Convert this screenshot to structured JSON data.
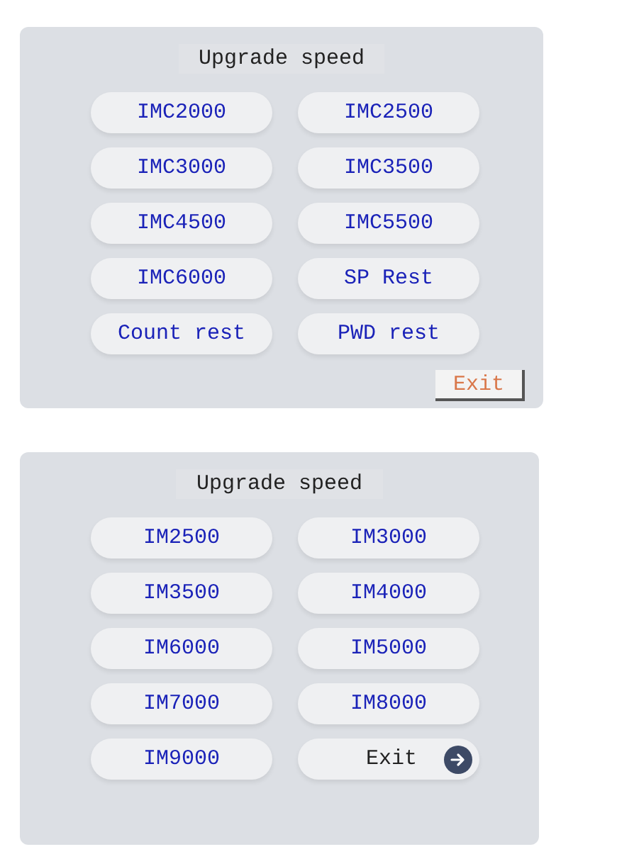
{
  "panels": [
    {
      "title": "Upgrade speed",
      "buttons": [
        {
          "label": "IMC2000",
          "kind": "plain"
        },
        {
          "label": "IMC2500",
          "kind": "plain"
        },
        {
          "label": "IMC3000",
          "kind": "plain"
        },
        {
          "label": "IMC3500",
          "kind": "plain"
        },
        {
          "label": "IMC4500",
          "kind": "plain"
        },
        {
          "label": "IMC5500",
          "kind": "plain"
        },
        {
          "label": "IMC6000",
          "kind": "plain"
        },
        {
          "label": "SP Rest",
          "kind": "plain"
        },
        {
          "label": "Count rest",
          "kind": "plain"
        },
        {
          "label": "PWD rest",
          "kind": "plain"
        }
      ],
      "exit": "Exit"
    },
    {
      "title": "Upgrade speed",
      "buttons": [
        {
          "label": "IM2500",
          "kind": "plain"
        },
        {
          "label": "IM3000",
          "kind": "plain"
        },
        {
          "label": "IM3500",
          "kind": "plain"
        },
        {
          "label": "IM4000",
          "kind": "plain"
        },
        {
          "label": "IM6000",
          "kind": "plain"
        },
        {
          "label": "IM5000",
          "kind": "plain"
        },
        {
          "label": "IM7000",
          "kind": "plain"
        },
        {
          "label": "IM8000",
          "kind": "plain"
        },
        {
          "label": "IM9000",
          "kind": "plain"
        },
        {
          "label": "Exit",
          "kind": "exit"
        }
      ]
    }
  ]
}
